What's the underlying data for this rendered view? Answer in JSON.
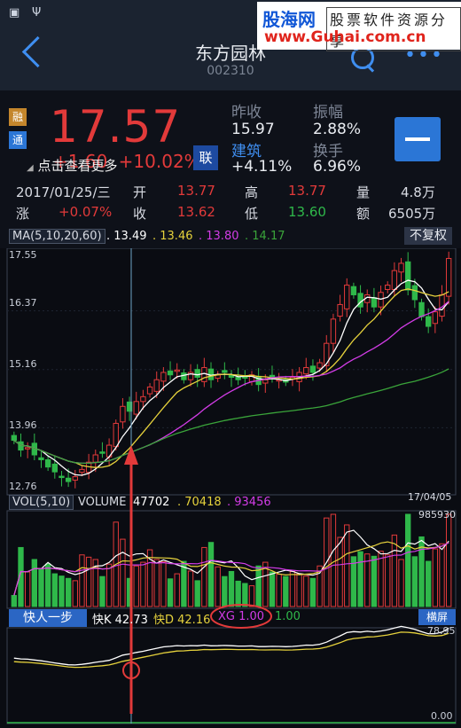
{
  "watermark": {
    "site": "股海网",
    "slogan": "股票软件资源分享",
    "url": "www.Guhai.com.cn"
  },
  "stock": {
    "name": "东方园林",
    "code": "002310",
    "price": "17.57",
    "change": "+1.60",
    "change_pct": "+10.02%",
    "badge1": "融",
    "badge2": "通",
    "more": "点击查看更多",
    "lian": "联"
  },
  "quote": {
    "prev_close_label": "昨收",
    "prev_close": "15.97",
    "amplitude_label": "振幅",
    "amplitude": "2.88%",
    "sector_label": "建筑",
    "sector_chg": "+4.11%",
    "turnover_label": "换手",
    "turnover": "6.96%"
  },
  "bar_info": {
    "date": "2017/01/25/三",
    "open_label": "开",
    "open": "13.77",
    "high_label": "高",
    "high": "13.77",
    "vol_label": "量",
    "vol": "4.8万",
    "rise_label": "涨",
    "rise": "+0.07%",
    "close_label": "收",
    "close": "13.62",
    "low_label": "低",
    "low": "13.60",
    "amt_label": "额",
    "amt": "6505万"
  },
  "ma_legend": {
    "tag": "MA(5,10,20,60)",
    "ma5": ". 13.49",
    "ma10": ". 13.46",
    "ma20": ". 13.80",
    "ma60": ". 14.17",
    "adj_button": "不复权"
  },
  "price_axis": {
    "max": "17.55",
    "l1": "16.37",
    "l2": "15.16",
    "l3": "13.96",
    "min": "12.76"
  },
  "vol_legend": {
    "tag": "VOL(5,10)",
    "label": "VOLUME",
    "v1": "47702",
    "v2": ". 70418",
    "v3": ". 93456",
    "date": "17/04/05",
    "max": "985930"
  },
  "ind_legend": {
    "btn": "快人一步",
    "k": "快K 42.73",
    "d": "快D 42.16",
    "xg": "XG 1.00",
    "extra": "1.00",
    "landscape": "横屏",
    "max": "78.95",
    "min": "0.00"
  },
  "colors": {
    "up": "#e23a3a",
    "down": "#2fb84a",
    "ma5": "#ffffff",
    "ma10": "#e6d23c",
    "ma20": "#d23ce6",
    "ma60": "#3aa43a",
    "accent": "#2b76d6"
  },
  "chart_data": {
    "type": "candlestick",
    "title": "",
    "close": [
      13.7,
      13.5,
      13.55,
      13.4,
      13.3,
      13.15,
      13.05,
      12.95,
      12.85,
      12.95,
      13.1,
      13.25,
      13.4,
      13.45,
      13.6,
      14.05,
      14.4,
      14.3,
      14.5,
      14.6,
      14.8,
      14.95,
      15.1,
      15.05,
      15.15,
      14.95,
      15.1,
      15.0,
      15.2,
      14.95,
      15.05,
      15.1,
      15.0,
      14.95,
      15.0,
      15.05,
      14.85,
      14.95,
      15.0,
      14.95,
      14.9,
      15.0,
      15.1,
      15.2,
      15.1,
      15.3,
      15.7,
      16.2,
      16.5,
      16.9,
      16.7,
      16.45,
      16.7,
      16.45,
      16.75,
      16.9,
      17.2,
      17.35,
      16.8,
      16.6,
      16.25,
      16.05,
      16.35,
      16.7,
      17.45
    ],
    "ma_series": [
      {
        "name": "MA5"
      },
      {
        "name": "MA10"
      },
      {
        "name": "MA20"
      },
      {
        "name": "MA60"
      }
    ],
    "ylim": [
      12.76,
      17.55
    ],
    "volume_ylim": [
      0,
      985930
    ],
    "indicator_ylim": [
      0,
      78.95
    ],
    "last_date": "17/04/05"
  }
}
